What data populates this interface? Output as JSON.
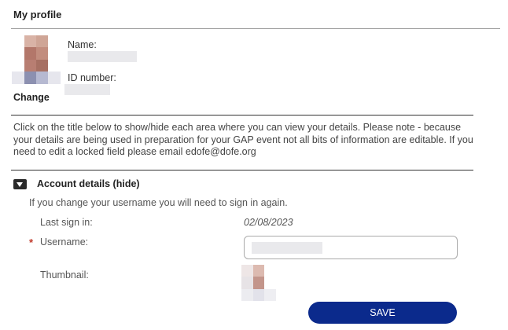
{
  "profile": {
    "section_title": "My profile",
    "name_label": "Name:",
    "id_label": "ID number:",
    "change_label": "Change"
  },
  "info_text": "Click on the title below to show/hide each area where you can view your details. Please note - because your details are being used in preparation for your GAP event not all bits of information are editable. If you need to edit a locked field please email edofe@dofe.org",
  "account": {
    "toggle_title": "Account details (hide)",
    "note": "If you change your username you will need to sign in again.",
    "last_sign_in_label": "Last sign in:",
    "last_sign_in_value": "02/08/2023",
    "required_marker": "*",
    "username_label": "Username:",
    "thumbnail_label": "Thumbnail:",
    "save_label": "SAVE"
  },
  "colors": {
    "primary_button": "#0b2a8c",
    "required": "#c0392b"
  }
}
